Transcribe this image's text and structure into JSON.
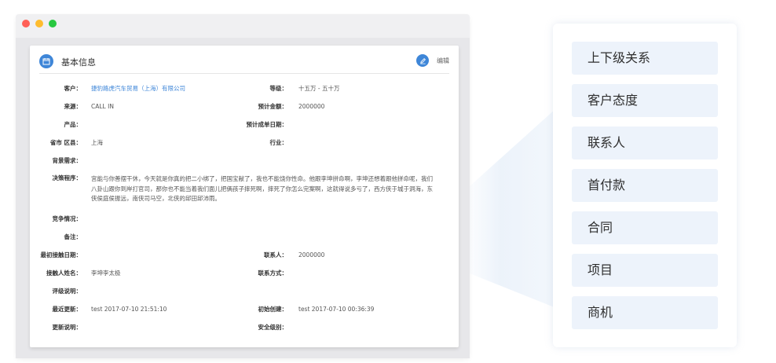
{
  "card": {
    "title": "基本信息",
    "edit_label": "编辑",
    "rows": {
      "customer": {
        "label": "客户：",
        "value": "捷豹路虎汽车贸易（上海）有限公司"
      },
      "level": {
        "label": "等级：",
        "value": "十五万 - 五十万"
      },
      "source": {
        "label": "来源：",
        "value": "CALL IN"
      },
      "est_amount": {
        "label": "预计金额：",
        "value": "2000000"
      },
      "product": {
        "label": "产品：",
        "value": ""
      },
      "est_close": {
        "label": "预计成单日期：",
        "value": ""
      },
      "region": {
        "label": "省市 区县：",
        "value": "上海"
      },
      "industry": {
        "label": "行业：",
        "value": ""
      },
      "background": {
        "label": "背景需求：",
        "value": ""
      },
      "decision": {
        "label": "决策程序：",
        "value": "宫能与你善摆干休，今天就是你真的把二小绑了，把国宝献了，我也不能饶你性命。他跟李坤拼命啊，李坤还想着跟他拼命呢，我们八卦山跟你到岸打官司，那你也不能当着我们面儿把俩孩子摔死啊，摔死了你怎么完案啊，这就得说多亏了，西方侠于城于洞海，东侠侯庭侯振远，南侠司马空，北侠的邱田邱沛雨。"
      },
      "competition": {
        "label": "竞争情况：",
        "value": ""
      },
      "remark": {
        "label": "备注：",
        "value": ""
      },
      "first_contact": {
        "label": "最初接触日期：",
        "value": ""
      },
      "contact": {
        "label": "联系人：",
        "value": "2000000"
      },
      "contact_name": {
        "label": "接触人姓名：",
        "value": "李坤李太极"
      },
      "contact_method": {
        "label": "联系方式：",
        "value": ""
      },
      "rating_note": {
        "label": "评级说明：",
        "value": ""
      },
      "last_update": {
        "label": "最近更新：",
        "value": "test 2017-07-10 21:51:10"
      },
      "created": {
        "label": "初始创建：",
        "value": "test 2017-07-10 00:36:39"
      },
      "update_note": {
        "label": "更新说明：",
        "value": ""
      },
      "security": {
        "label": "安全级别：",
        "value": ""
      }
    }
  },
  "panel": {
    "items": [
      "上下级关系",
      "客户态度",
      "联系人",
      "首付款",
      "合同",
      "项目",
      "商机"
    ]
  },
  "colors": {
    "accent": "#3e86d8",
    "panel_item_bg": "#edf3fb",
    "window_bg": "#f0f0f2"
  },
  "icons": {
    "card_icon": "calendar-icon",
    "edit_icon": "pencil-icon"
  }
}
